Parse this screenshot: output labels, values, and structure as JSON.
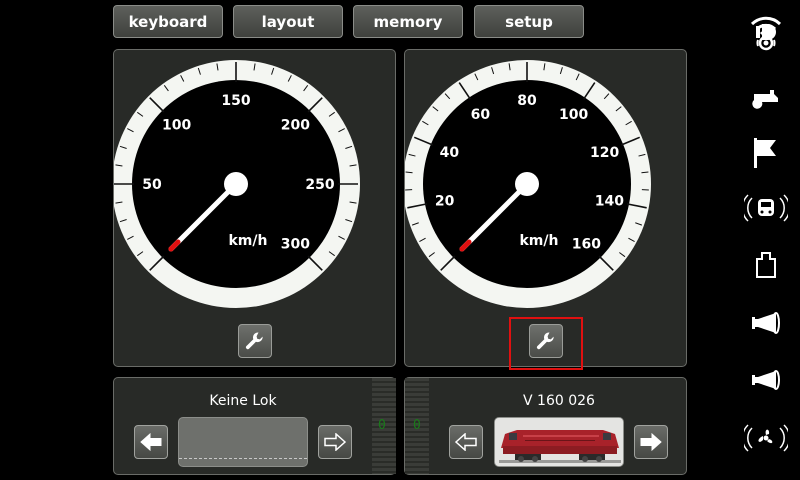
{
  "tabs": [
    {
      "label": "keyboard"
    },
    {
      "label": "layout"
    },
    {
      "label": "memory"
    },
    {
      "label": "setup"
    }
  ],
  "gauges": [
    {
      "unit": "km/h",
      "max": 300,
      "labels": [
        "50",
        "100",
        "150",
        "200",
        "250",
        "300"
      ],
      "label_values": [
        50,
        100,
        150,
        200,
        250,
        300
      ],
      "speed": 0
    },
    {
      "unit": "km/h",
      "max": 160,
      "labels": [
        "20",
        "40",
        "60",
        "80",
        "100",
        "120",
        "140",
        "160"
      ],
      "label_values": [
        20,
        40,
        60,
        80,
        100,
        120,
        140,
        160
      ],
      "speed": 0
    }
  ],
  "loks": [
    {
      "name": "Keine Lok",
      "speed_digit": "0"
    },
    {
      "name": "V 160 026",
      "speed_digit": "0"
    }
  ],
  "colors": {
    "accent_red": "#e01010",
    "needle_red": "#e01010",
    "speed_digit_green": "#1a7a1a"
  },
  "function_icons": [
    "wifi-icon",
    "headlight-icon",
    "whistle-icon",
    "flag-icon",
    "train-sound-icon",
    "coupler-icon",
    "horn-high-icon",
    "horn-low-icon",
    "fan-sound-icon"
  ]
}
